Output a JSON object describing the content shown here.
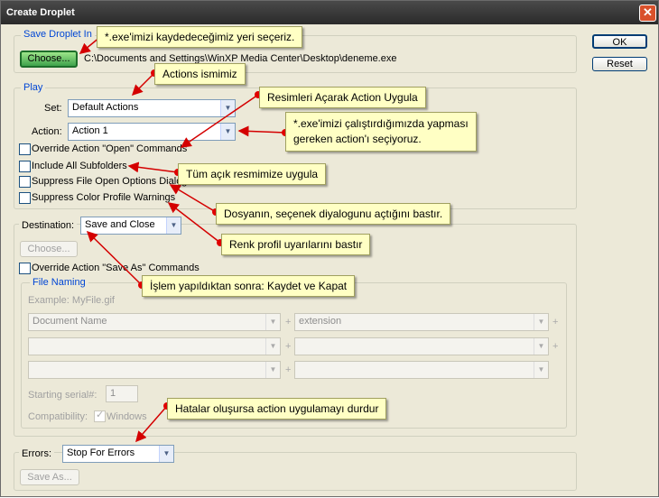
{
  "window": {
    "title": "Create Droplet"
  },
  "buttons": {
    "ok": "OK",
    "reset": "Reset"
  },
  "save_droplet": {
    "legend": "Save Droplet In",
    "choose_label": "Choose...",
    "path": "C:\\Documents and Settings\\WinXP Media Center\\Desktop\\deneme.exe"
  },
  "play": {
    "legend": "Play",
    "set_label": "Set:",
    "set_value": "Default Actions",
    "action_label": "Action:",
    "action_value": "Action 1",
    "options": [
      {
        "label": "Override Action \"Open\" Commands",
        "checked": false
      },
      {
        "label": "Include All Subfolders",
        "checked": false
      },
      {
        "label": "Suppress File Open Options Dialogs",
        "checked": false
      },
      {
        "label": "Suppress Color Profile Warnings",
        "checked": false
      }
    ]
  },
  "destination": {
    "label": "Destination:",
    "value": "Save and Close",
    "choose_label": "Choose...",
    "override_label": "Override Action \"Save As\" Commands",
    "file_naming": {
      "legend": "File Naming",
      "example": "Example: MyFile.gif",
      "field1": "Document Name",
      "field2": "extension",
      "plus": "+",
      "serial_label": "Starting serial#:",
      "serial_value": "1",
      "compat_label": "Compatibility:",
      "windows_label": "Windows"
    }
  },
  "errors": {
    "label": "Errors:",
    "value": "Stop For Errors",
    "save_as_label": "Save As..."
  },
  "callouts": {
    "c1": "*.exe'imizi kaydedeceğimiz yeri seçeriz.",
    "c2": "Actions ismimiz",
    "c3": "Resimleri Açarak Action Uygula",
    "c4a": "*.exe'imizi çalıştırdığımızda yapması",
    "c4b": "gereken action'ı seçiyoruz.",
    "c5": "Tüm açık resmimize uygula",
    "c6": "Dosyanın, seçenek diyalogunu açtığını bastır.",
    "c7": "Renk profil uyarılarını bastır",
    "c8": "İşlem yapıldıktan sonra: Kaydet ve Kapat",
    "c9": "Hatalar oluşursa action uygulamayı durdur"
  },
  "colors": {
    "legend": "#0046d5",
    "callout_bg": "#ffffc4",
    "arrow": "#d40000",
    "dot": "#e00000"
  }
}
